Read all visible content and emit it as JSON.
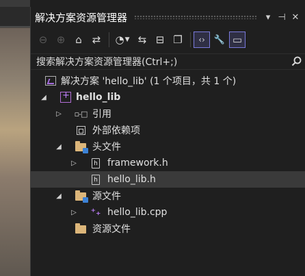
{
  "panel": {
    "title": "解决方案资源管理器",
    "window_buttons": [
      "▾",
      "⊣",
      "✕"
    ]
  },
  "toolbar": {
    "buttons": [
      {
        "name": "back-icon",
        "glyph": "⊖"
      },
      {
        "name": "forward-icon",
        "glyph": "⊕"
      },
      {
        "name": "home-icon",
        "glyph": "⌂"
      },
      {
        "name": "switch-views-icon",
        "glyph": "⇄"
      },
      {
        "name": "pending-changes-filter-icon",
        "glyph": "◔"
      },
      {
        "name": "sync-with-active-document-icon",
        "glyph": "⇆"
      },
      {
        "name": "collapse-all-icon",
        "glyph": "⊟"
      },
      {
        "name": "show-all-files-icon",
        "glyph": "❐"
      },
      {
        "name": "preview-selected-items-icon",
        "glyph": "‹›"
      },
      {
        "name": "properties-icon",
        "glyph": "🔧"
      },
      {
        "name": "toggle-icon",
        "glyph": "▭"
      }
    ]
  },
  "search": {
    "placeholder": "搜索解决方案资源管理器(Ctrl+;)"
  },
  "tree": {
    "solution_label": "解决方案 'hello_lib' (1 个项目，共 1 个)",
    "project_label": "hello_lib",
    "references_label": "引用",
    "external_deps_label": "外部依赖项",
    "header_folder_label": "头文件",
    "header_file_1": "framework.h",
    "header_file_2": "hello_lib.h",
    "source_folder_label": "源文件",
    "source_file_1": "hello_lib.cpp",
    "resource_folder_label": "资源文件"
  },
  "colors": {
    "background": "#1f1f1f",
    "selection": "#3a3a3a",
    "folder": "#dcb67a",
    "accent_purple": "#b26ed6",
    "active_button_border": "#7a7adb"
  }
}
